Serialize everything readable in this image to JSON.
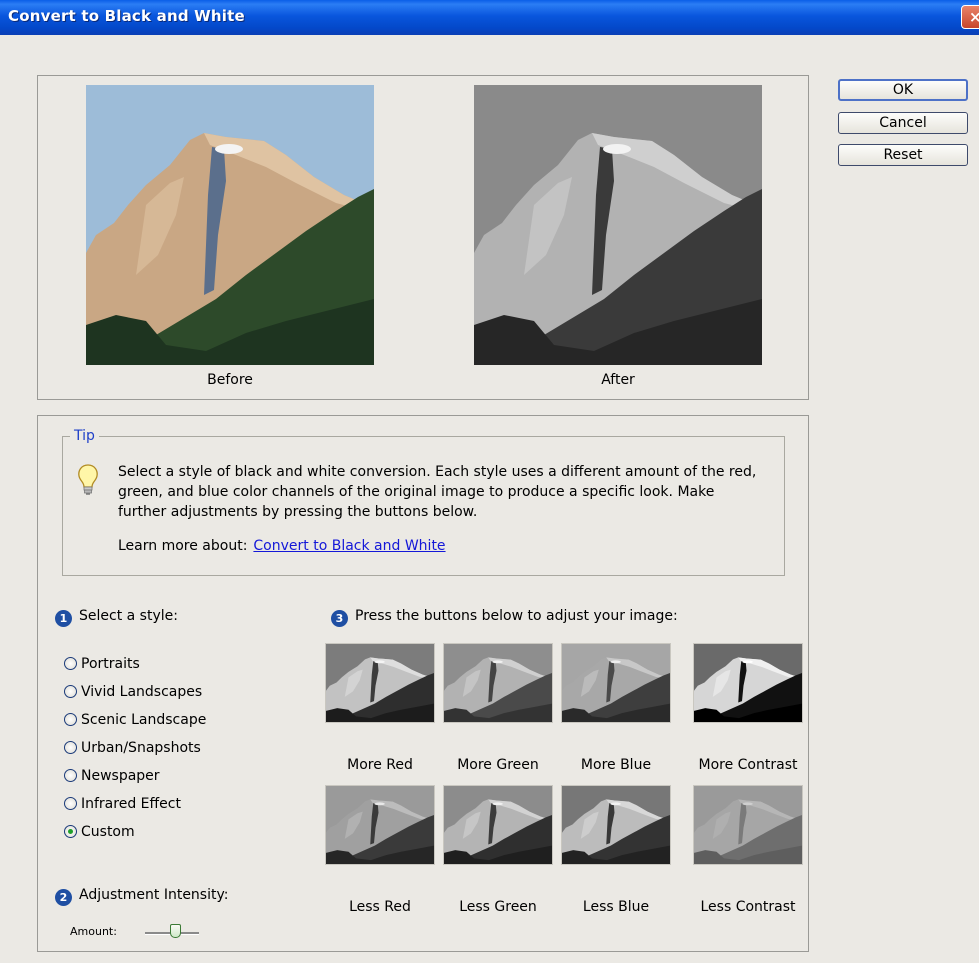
{
  "window": {
    "title": "Convert to Black and White",
    "close_glyph": "×"
  },
  "buttons": {
    "ok": "OK",
    "cancel": "Cancel",
    "reset": "Reset"
  },
  "preview": {
    "before_label": "Before",
    "after_label": "After"
  },
  "tip": {
    "legend": "Tip",
    "text": "Select a style of black and white conversion. Each style uses a different amount of the red, green, and blue color channels of the original image to produce a specific look. Make further adjustments by pressing the buttons below.",
    "learn_prefix": "Learn more about:",
    "learn_link": "Convert to Black and White"
  },
  "style_section": {
    "number": "1",
    "heading": "Select a style:",
    "options": [
      {
        "label": "Portraits",
        "selected": false
      },
      {
        "label": "Vivid Landscapes",
        "selected": false
      },
      {
        "label": "Scenic Landscape",
        "selected": false
      },
      {
        "label": "Urban/Snapshots",
        "selected": false
      },
      {
        "label": "Newspaper",
        "selected": false
      },
      {
        "label": "Infrared Effect",
        "selected": false
      },
      {
        "label": "Custom",
        "selected": true
      }
    ]
  },
  "intensity_section": {
    "number": "2",
    "heading": "Adjustment Intensity:",
    "amount_label": "Amount:"
  },
  "adjust_section": {
    "number": "3",
    "heading": "Press the buttons below to adjust your image:",
    "buttons": [
      {
        "label": "More Red"
      },
      {
        "label": "More Green"
      },
      {
        "label": "More Blue"
      },
      {
        "label": "More Contrast"
      },
      {
        "label": "Less Red"
      },
      {
        "label": "Less Green"
      },
      {
        "label": "Less Blue"
      },
      {
        "label": "Less Contrast"
      }
    ]
  }
}
